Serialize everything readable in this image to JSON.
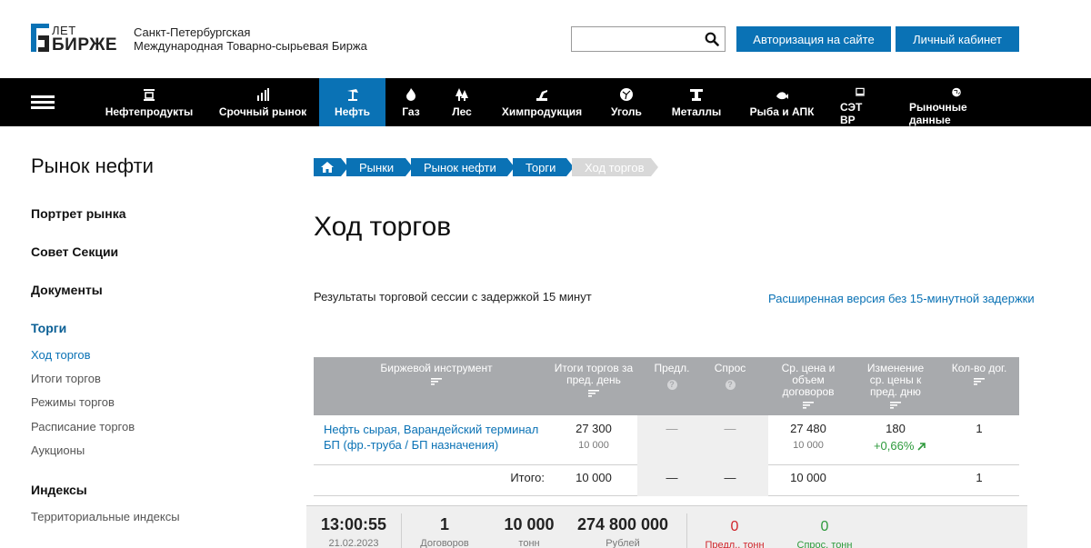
{
  "header": {
    "logo_years": "ЛЕТ",
    "logo_word": "БИРЖЕ",
    "org_line1": "Санкт-Петербургская",
    "org_line2": "Международная Товарно-сырьевая Биржа",
    "search_value": "",
    "search_placeholder": "",
    "auth_button": "Авторизация на сайте",
    "cabinet_button": "Личный кабинет",
    "accent_color": "#0a72b5"
  },
  "nav": {
    "items": [
      {
        "label": "Нефтепродукты",
        "icon": "oil-products-icon"
      },
      {
        "label": "Срочный рынок",
        "icon": "chart-bars-icon"
      },
      {
        "label": "Нефть",
        "icon": "oil-derrick-icon"
      },
      {
        "label": "Газ",
        "icon": "flame-icon"
      },
      {
        "label": "Лес",
        "icon": "trees-icon"
      },
      {
        "label": "Химпродукция",
        "icon": "chemistry-icon"
      },
      {
        "label": "Уголь",
        "icon": "coal-icon"
      },
      {
        "label": "Металлы",
        "icon": "metal-icon"
      },
      {
        "label": "Рыба и АПК",
        "icon": "fish-icon"
      },
      {
        "label": "СЭТ ВР",
        "icon": "monitor-icon"
      },
      {
        "label": "Рыночные данные",
        "icon": "globe-icon"
      }
    ],
    "active": "Нефть"
  },
  "sidebar": {
    "title": "Рынок нефти",
    "sections": [
      {
        "label": "Портрет рынка"
      },
      {
        "label": "Совет Секции"
      },
      {
        "label": "Документы"
      },
      {
        "label": "Торги"
      },
      {
        "label": "Индексы"
      }
    ],
    "torgi_items": [
      {
        "label": "Ход торгов"
      },
      {
        "label": "Итоги торгов"
      },
      {
        "label": "Режимы торгов"
      },
      {
        "label": "Расписание торгов"
      },
      {
        "label": "Аукционы"
      }
    ],
    "index_items": [
      {
        "label": "Территориальные индексы"
      }
    ]
  },
  "breadcrumb": {
    "items": [
      "Рынки",
      "Рынок нефти",
      "Торги",
      "Ход торгов"
    ]
  },
  "main": {
    "title": "Ход торгов",
    "session_note": "Результаты торговой сессии с задержкой 15 минут",
    "ext_link": "Расширенная версия без 15-минутной задержки"
  },
  "table": {
    "headers": {
      "instrument": "Биржевой инструмент",
      "prev_total": "Итоги торгов за пред. день",
      "offer": "Предл.",
      "demand": "Спрос",
      "avg_price": "Ср. цена и объем договоров",
      "change": "Изменение ср. цены к пред. дню",
      "count": "Кол-во дог."
    },
    "row": {
      "instrument": "Нефть сырая, Варандейский терминал БП (фр.-труба / БП назначения)",
      "prev_price": "27 300",
      "prev_volume": "10 000",
      "offer": "—",
      "demand": "—",
      "avg_price": "27 480",
      "avg_volume": "10 000",
      "change_abs": "180",
      "change_pct": "+0,66%",
      "count": "1"
    },
    "total": {
      "label": "Итого:",
      "prev_volume": "10 000",
      "offer": "—",
      "demand": "—",
      "avg_volume": "10 000",
      "count": "1"
    }
  },
  "summary": {
    "time": "13:00:55",
    "date": "21.02.2023",
    "contracts": "1",
    "contracts_label": "Договоров",
    "tons": "10 000",
    "tons_label": "тонн",
    "rubles": "274 800 000",
    "rubles_label": "Рублей",
    "offer_tons": "0",
    "offer_label": "Предл., тонн",
    "demand_tons": "0",
    "demand_label": "Спрос, тонн"
  }
}
